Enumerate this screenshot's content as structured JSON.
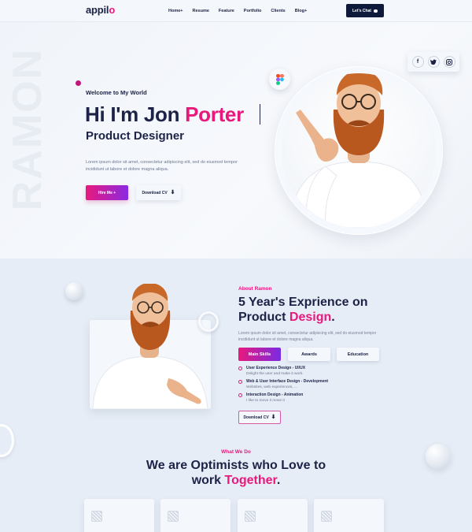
{
  "nav": {
    "logo_main": "appil",
    "logo_accent": "o",
    "menu": [
      "Home+",
      "Resume",
      "Feature",
      "Portfolio",
      "Clients",
      "Blog+"
    ],
    "chat_button": "Let's Chat"
  },
  "hero": {
    "background_word": "RAMON",
    "welcome": "Welcome to My World",
    "greeting": "Hi I'm Jon ",
    "name": "Porter",
    "role": "Product Designer",
    "description": "Lorem ipsum dolor sit amet, consectetur adipiscing elit, sed do eiusmod tempor incididunt ut labore et dolore magna aliqua.",
    "hire_button": "Hire Me +",
    "download_button": "Download CV",
    "social": [
      "f",
      "t",
      "ig"
    ]
  },
  "about": {
    "kicker": "About Ramon",
    "headline_line1": "5 Year's Exprience on",
    "headline_line2_prefix": "Product ",
    "headline_line2_accent": "Design",
    "headline_line2_suffix": ".",
    "description": "Lorem ipsum dolor sit amet, consectetur adipiscing elit, sed do eiusmod tempor incididunt ut labore et dolore magna aliqua.",
    "tabs": [
      "Main Skills",
      "Awards",
      "Education"
    ],
    "skills": [
      {
        "title": "User Experience Design - UI/UX",
        "desc": "Delight the user and make it work."
      },
      {
        "title": "Web & User Interface Design - Development",
        "desc": "Websites, web experiences, ..."
      },
      {
        "title": "Interaction Design - Animation",
        "desc": "I like to move it move it"
      }
    ],
    "download_button": "Download CV"
  },
  "services": {
    "kicker": "What We Do",
    "headline_line1": "We are Optimists who Love to",
    "headline_line2_prefix": "work ",
    "headline_line2_accent": "Together",
    "headline_line2_suffix": "."
  },
  "colors": {
    "accent": "#e8197d",
    "navy": "#1c2346",
    "gradient_end": "#8a2be2",
    "background": "#eef3f9"
  }
}
